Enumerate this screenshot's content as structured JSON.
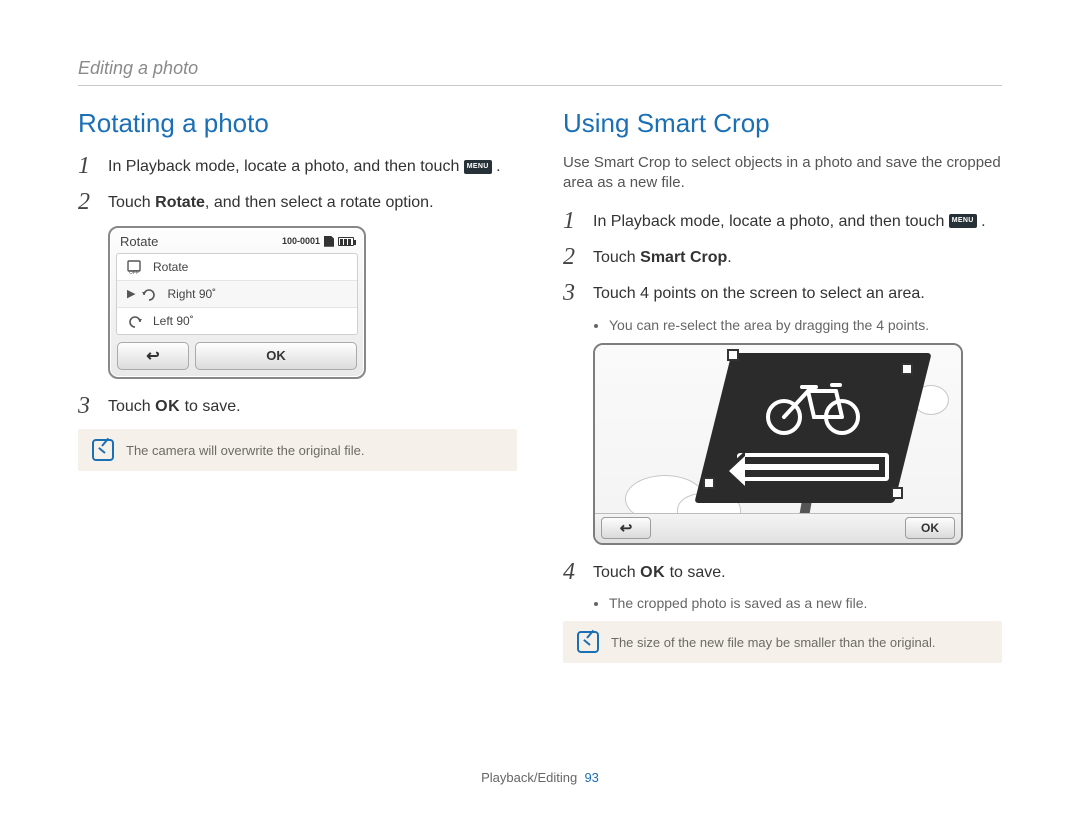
{
  "breadcrumb": "Editing a photo",
  "footer_section": "Playback/Editing",
  "footer_page": "93",
  "icons": {
    "menu_label": "MENU",
    "ok_label": "OK",
    "back_glyph": "↩"
  },
  "left": {
    "heading": "Rotating a photo",
    "steps": [
      {
        "n": "1",
        "pre": "In Playback mode, locate a photo, and then touch ",
        "post": "."
      },
      {
        "n": "2",
        "pre": "Touch ",
        "bold": "Rotate",
        "post": ", and then select a rotate option."
      },
      {
        "n": "3",
        "pre": "Touch ",
        "ok": true,
        "post": " to save."
      }
    ],
    "dialog": {
      "title": "Rotate",
      "file_no": "100-0001",
      "rows": [
        {
          "label": "Rotate"
        },
        {
          "label": "Right 90˚",
          "selected": true
        },
        {
          "label": "Left 90˚"
        }
      ],
      "ok": "OK"
    },
    "note": "The camera will overwrite the original file."
  },
  "right": {
    "heading": "Using Smart Crop",
    "intro": "Use Smart Crop to select objects in a photo and save the cropped area as a new file.",
    "steps": [
      {
        "n": "1",
        "pre": "In Playback mode, locate a photo, and then touch ",
        "post": "."
      },
      {
        "n": "2",
        "pre": "Touch ",
        "bold": "Smart Crop",
        "post": "."
      },
      {
        "n": "3",
        "pre": "Touch 4 points on the screen to select an area.",
        "post": ""
      },
      {
        "n": "4",
        "pre": "Touch ",
        "ok": true,
        "post": " to save."
      }
    ],
    "step3_sub": "You can re-select the area by dragging the 4 points.",
    "step4_sub": "The cropped photo is saved as a new file.",
    "preview": {
      "ok": "OK"
    },
    "note": "The size of the new file may be smaller than the original."
  }
}
